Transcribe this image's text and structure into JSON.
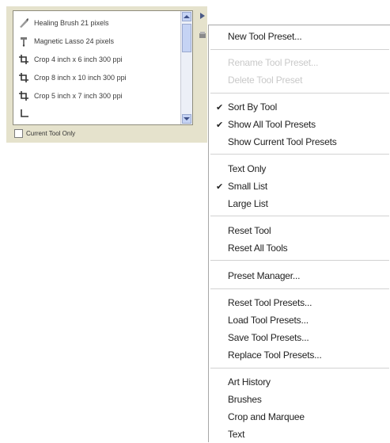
{
  "panel": {
    "items": [
      {
        "label": "Healing Brush 21 pixels",
        "icon": "healing-brush-icon"
      },
      {
        "label": "Magnetic Lasso 24 pixels",
        "icon": "magnetic-lasso-icon"
      },
      {
        "label": "Crop 4 inch x 6 inch 300 ppi",
        "icon": "crop-icon"
      },
      {
        "label": "Crop 8 inch x 10 inch 300 ppi",
        "icon": "crop-icon"
      },
      {
        "label": "Crop 5 inch x 7 inch 300 ppi",
        "icon": "crop-icon"
      }
    ],
    "current_tool_only_label": "Current Tool Only",
    "current_tool_only_checked": false
  },
  "menu": {
    "items": [
      {
        "label": "New Tool Preset...",
        "enabled": true,
        "checked": false
      },
      {
        "label": "Rename Tool Preset...",
        "enabled": false,
        "checked": false
      },
      {
        "label": "Delete Tool Preset",
        "enabled": false,
        "checked": false
      },
      {
        "label": "Sort By Tool",
        "enabled": true,
        "checked": true
      },
      {
        "label": "Show All Tool Presets",
        "enabled": true,
        "checked": true
      },
      {
        "label": "Show Current Tool Presets",
        "enabled": true,
        "checked": false
      },
      {
        "label": "Text Only",
        "enabled": true,
        "checked": false
      },
      {
        "label": "Small List",
        "enabled": true,
        "checked": true
      },
      {
        "label": "Large List",
        "enabled": true,
        "checked": false
      },
      {
        "label": "Reset Tool",
        "enabled": true,
        "checked": false
      },
      {
        "label": "Reset All Tools",
        "enabled": true,
        "checked": false
      },
      {
        "label": "Preset Manager...",
        "enabled": true,
        "checked": false
      },
      {
        "label": "Reset Tool Presets...",
        "enabled": true,
        "checked": false
      },
      {
        "label": "Load Tool Presets...",
        "enabled": true,
        "checked": false
      },
      {
        "label": "Save Tool Presets...",
        "enabled": true,
        "checked": false
      },
      {
        "label": "Replace Tool Presets...",
        "enabled": true,
        "checked": false
      },
      {
        "label": "Art History",
        "enabled": true,
        "checked": false
      },
      {
        "label": "Brushes",
        "enabled": true,
        "checked": false
      },
      {
        "label": "Crop and Marquee",
        "enabled": true,
        "checked": false
      },
      {
        "label": "Text",
        "enabled": true,
        "checked": false
      }
    ],
    "check_glyph": "✔"
  },
  "colors": {
    "panel_bg": "#e5e2cc",
    "scroll_accent": "#c5d3f4",
    "disabled_text": "#c9c9c9"
  }
}
